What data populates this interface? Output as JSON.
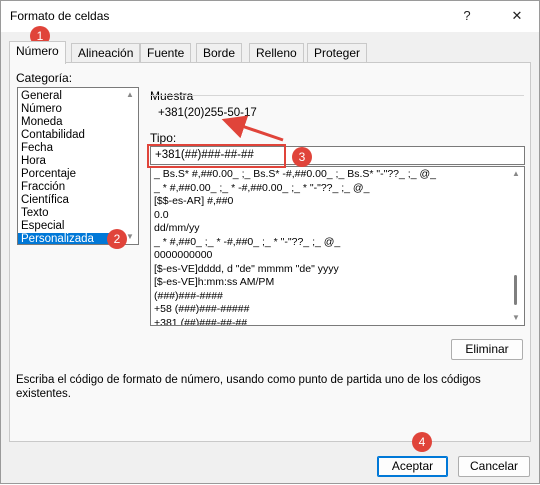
{
  "window": {
    "title": "Formato de celdas",
    "help_label": "?",
    "close_label": "✕"
  },
  "tabs": [
    {
      "label": "Número",
      "active": true
    },
    {
      "label": "Alineación",
      "active": false
    },
    {
      "label": "Fuente",
      "active": false
    },
    {
      "label": "Borde",
      "active": false
    },
    {
      "label": "Relleno",
      "active": false
    },
    {
      "label": "Proteger",
      "active": false
    }
  ],
  "category": {
    "label": "Categoría:",
    "items": [
      "General",
      "Número",
      "Moneda",
      "Contabilidad",
      "Fecha",
      "Hora",
      "Porcentaje",
      "Fracción",
      "Científica",
      "Texto",
      "Especial",
      "Personalizada"
    ],
    "selected": "Personalizada"
  },
  "sample": {
    "label": "Muestra",
    "value": "+381(20)255-50-17"
  },
  "type": {
    "label": "Tipo:",
    "value": "+381(##)###-##-##",
    "formats": [
      "_ Bs.S* #,##0.00_ ;_ Bs.S* -#,##0.00_ ;_ Bs.S* \"-\"??_ ;_ @_",
      "_ * #,##0.00_ ;_ * -#,##0.00_ ;_ * \"-\"??_ ;_ @_",
      "[$$-es-AR] #,##0",
      "0.0",
      "dd/mm/yy",
      "_ * #,##0_ ;_ * -#,##0_ ;_ * \"-\"??_ ;_ @_",
      "0000000000",
      "[$-es-VE]dddd, d \"de\" mmmm \"de\" yyyy",
      "[$-es-VE]h:mm:ss AM/PM",
      "(###)###-####",
      "+58 (###)###-#####",
      "+381 (##)###-##-##"
    ]
  },
  "buttons": {
    "delete": "Eliminar",
    "ok": "Aceptar",
    "cancel": "Cancelar"
  },
  "hint": "Escriba el código de formato de número, usando como punto de partida uno de los códigos existentes.",
  "callouts": [
    "1",
    "2",
    "3",
    "4"
  ],
  "colors": {
    "accent": "#0078d7",
    "annotation": "#e0443a"
  }
}
